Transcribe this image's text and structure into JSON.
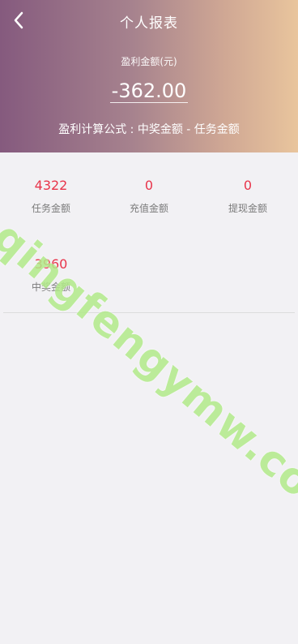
{
  "header": {
    "title": "个人报表",
    "profit_label": "盈利金额(元)",
    "profit_value": "-362.00",
    "formula": "盈利计算公式 : 中奖金额 - 任务金额"
  },
  "stats": [
    {
      "value": "4322",
      "label": "任务金额"
    },
    {
      "value": "0",
      "label": "充值金额"
    },
    {
      "value": "0",
      "label": "提现金额"
    },
    {
      "value": "3960",
      "label": "中奖金额"
    }
  ],
  "watermark": "qingfengymw.com",
  "colors": {
    "accent_red": "#e8344a",
    "header_gradient_start": "#855a7e",
    "header_gradient_end": "#e9c59d"
  }
}
